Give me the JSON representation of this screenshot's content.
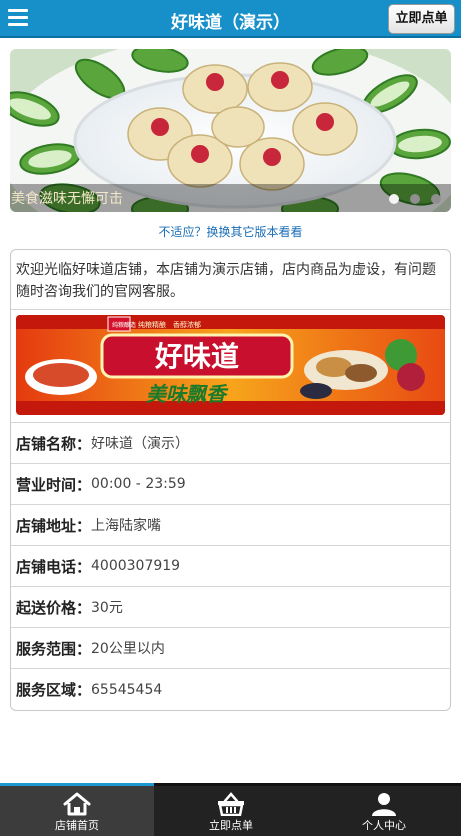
{
  "header": {
    "title": "好味道（演示）",
    "order_button": "立即点单"
  },
  "banner": {
    "caption": "美食滋味无懈可击",
    "slide_count": 3,
    "active_slide": 1
  },
  "switch_link": "不适应？换换其它版本看看",
  "store": {
    "welcome": "欢迎光临好味道店铺，本店铺为演示店铺，店内商品为虚设，有问题随时咨询我们的官网客服。",
    "ad": {
      "brand": "好味道",
      "slogan": "美味飘香",
      "tag_small": "纯粮酿造",
      "tag_line": "纯粮精酿　香醇浓郁"
    },
    "info": [
      {
        "label": "店铺名称：",
        "value": "好味道（演示）"
      },
      {
        "label": "营业时间：",
        "value": "00:00 - 23:59"
      },
      {
        "label": "店铺地址：",
        "value": "上海陆家嘴"
      },
      {
        "label": "店铺电话：",
        "value": "4000307919"
      },
      {
        "label": "起送价格：",
        "value": "30元"
      },
      {
        "label": "服务范围：",
        "value": "20公里以内"
      },
      {
        "label": "服务区域：",
        "value": "65545454"
      }
    ]
  },
  "footer": {
    "tabs": [
      {
        "label": "店铺首页",
        "icon": "home-icon",
        "active": true
      },
      {
        "label": "立即点单",
        "icon": "basket-icon",
        "active": false
      },
      {
        "label": "个人中心",
        "icon": "user-icon",
        "active": false
      }
    ]
  },
  "colors": {
    "header": "#1790c9",
    "link": "#1a6eb7",
    "footer": "#222222",
    "footer_active_bar": "#1c98d0"
  }
}
